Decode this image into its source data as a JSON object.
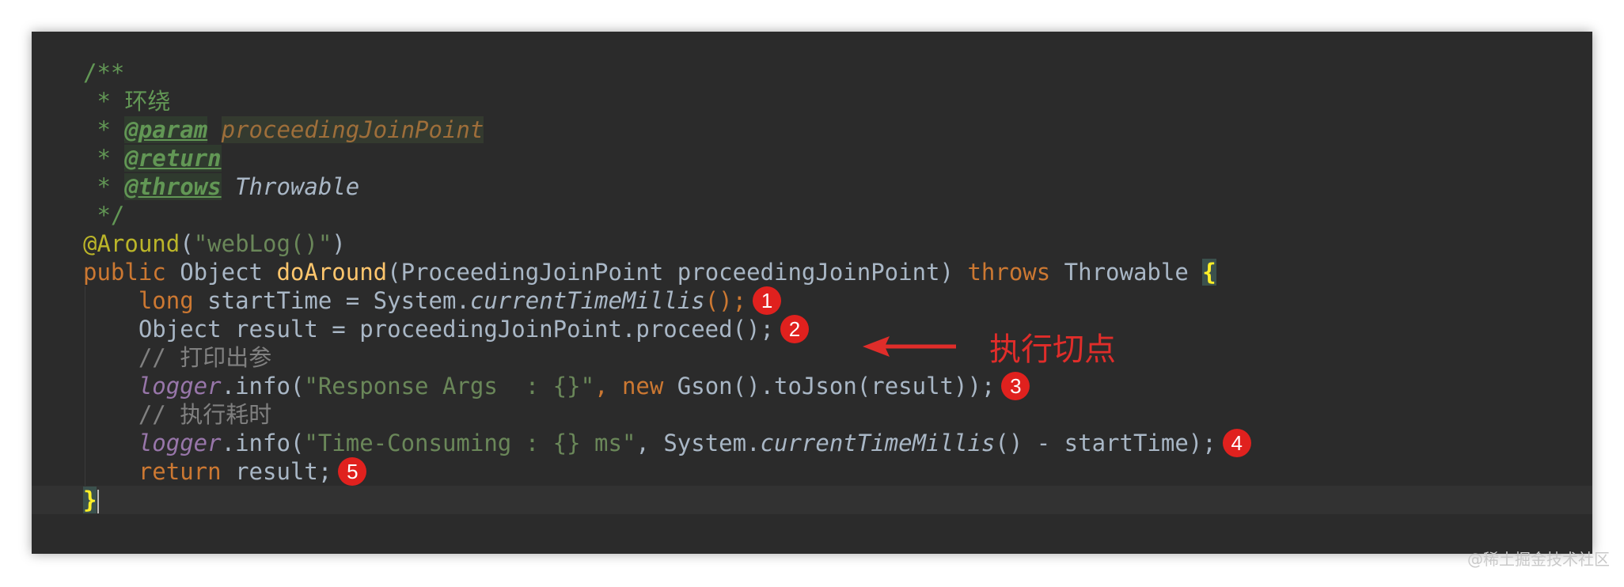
{
  "editor": {
    "doc": {
      "open": "/**",
      "desc": " * 环绕",
      "star": " * ",
      "param_tag": "@param",
      "param_name": "proceedingJoinPoint",
      "return_tag": "@return",
      "throws_tag": "@throws",
      "throws_type": "Throwable",
      "close": " */"
    },
    "annotation": "@Around",
    "annotation_arg": "\"webLog()\"",
    "sig": {
      "public": "public",
      "ret": " Object ",
      "name": "doAround",
      "params": "(ProceedingJoinPoint proceedingJoinPoint) ",
      "throws": "throws",
      "exc": " Throwable ",
      "brace": "{"
    },
    "l1": {
      "kw": "long",
      "text": " startTime = System.",
      "method": "currentTimeMillis",
      "end": "();"
    },
    "l2": {
      "text": "Object result = proceedingJoinPoint.proceed();"
    },
    "c1": "// 打印出参",
    "l3": {
      "logger": "logger",
      "call": ".info(",
      "str": "\"Response Args  : {}\"",
      "sep": ", ",
      "new": "new",
      "rest": " Gson().toJson(result));"
    },
    "c2": "// 执行耗时",
    "l4": {
      "logger": "logger",
      "call": ".info(",
      "str": "\"Time-Consuming : {} ms\"",
      "mid": ", System.",
      "method": "currentTimeMillis",
      "rest": "() - startTime);"
    },
    "l5": {
      "kw": "return",
      "rest": " result;"
    },
    "close_brace": "}"
  },
  "markers": [
    "1",
    "2",
    "3",
    "4",
    "5"
  ],
  "callout": {
    "text": "执行切点",
    "color": "#e02d2a"
  },
  "watermark": "@稀土掘金技术社区",
  "colors": {
    "background": "#2b2b2b",
    "keyword": "#cc7832",
    "string": "#6a8759",
    "comment": "#629755",
    "method_decl": "#ffc66d",
    "field": "#9876aa",
    "marker": "#e0211e"
  }
}
